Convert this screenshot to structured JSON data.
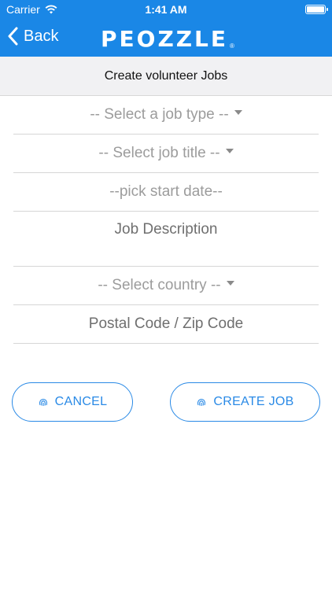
{
  "status": {
    "carrier": "Carrier",
    "time": "1:41 AM"
  },
  "nav": {
    "back_label": "Back",
    "logo_text": "PEOZZLE",
    "logo_reg": "®"
  },
  "header": {
    "title": "Create volunteer Jobs"
  },
  "form": {
    "job_type": "-- Select a job type --",
    "job_title": "-- Select job title --",
    "start_date": "--pick start date--",
    "description": "Job Description",
    "country": "-- Select country --",
    "postal_code": "Postal Code / Zip Code"
  },
  "buttons": {
    "cancel": "CANCEL",
    "create": "CREATE JOB"
  },
  "colors": {
    "brand": "#1a87e6",
    "accent": "#2a8ae6"
  }
}
